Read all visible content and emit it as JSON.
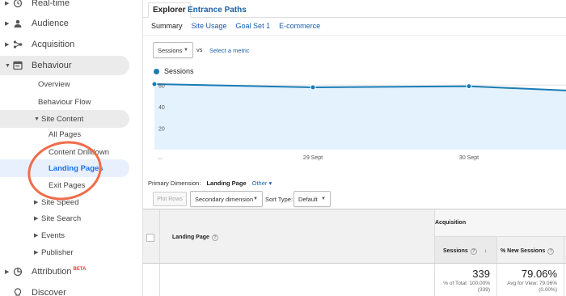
{
  "sidebar": {
    "items": [
      {
        "label": "Real-time",
        "icon": "clock-icon"
      },
      {
        "label": "Audience",
        "icon": "person-icon"
      },
      {
        "label": "Acquisition",
        "icon": "acquisition-icon"
      },
      {
        "label": "Behaviour",
        "icon": "behaviour-icon"
      },
      {
        "label": "Overview"
      },
      {
        "label": "Behaviour Flow"
      },
      {
        "label": "Site Content"
      },
      {
        "label": "All Pages"
      },
      {
        "label": "Content Drilldown"
      },
      {
        "label": "Landing Pages"
      },
      {
        "label": "Exit Pages"
      },
      {
        "label": "Site Speed"
      },
      {
        "label": "Site Search"
      },
      {
        "label": "Events"
      },
      {
        "label": "Publisher"
      },
      {
        "label": "Attribution",
        "icon": "attribution-icon",
        "badge": "BETA"
      },
      {
        "label": "Discover",
        "icon": "lightbulb-icon"
      }
    ]
  },
  "tabs": [
    "Explorer",
    "Entrance Paths"
  ],
  "subtabs": [
    "Summary",
    "Site Usage",
    "Goal Set 1",
    "E-commerce"
  ],
  "metric_select": {
    "value": "Sessions",
    "vs": "vs",
    "select_metric": "Select a metric"
  },
  "chart_data": {
    "type": "line",
    "series": [
      {
        "name": "Sessions",
        "values": [
          61,
          58,
          59,
          55
        ]
      }
    ],
    "x": [
      "...",
      "29 Sept",
      "30 Sept",
      ""
    ],
    "x_tick_labels": [
      "...",
      "29 Sept",
      "30 Sept"
    ],
    "y_ticks": [
      "60",
      "40",
      "20"
    ],
    "ylim": [
      0,
      70
    ],
    "colors": {
      "line": "#1a7cb5",
      "fill": "#e3f2fd"
    }
  },
  "dimension": {
    "label": "Primary Dimension:",
    "value": "Landing Page",
    "other": "Other"
  },
  "toolbar": {
    "plot_rows": "Plot Rows",
    "secondary_dimension": "Secondary dimension",
    "sort_type_label": "Sort Type:",
    "sort_type_value": "Default"
  },
  "table": {
    "group_header": "Acquisition",
    "col_landing": "Landing Page",
    "col_sessions": "Sessions",
    "col_new_sessions": "% New Sessions",
    "totals": {
      "sessions": "339",
      "sessions_sub1": "% of Total: 100.00%",
      "sessions_sub2": "(339)",
      "new_sessions": "79.06%",
      "new_sessions_sub1": "Avg for View: 79.06%",
      "new_sessions_sub2": "(0.00%)"
    }
  },
  "colors": {
    "accent": "#1a5fa8",
    "highlight": "#e8f0fe",
    "annotation": "#ef6c4a"
  }
}
